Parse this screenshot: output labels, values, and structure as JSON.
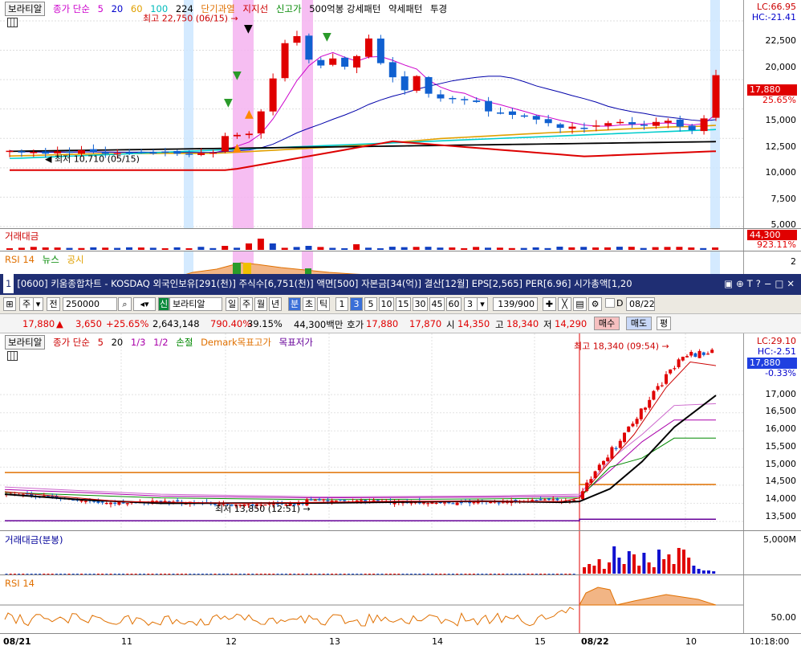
{
  "top_chart": {
    "legend": {
      "tag": "보라티알",
      "ma_label": "종가 단순",
      "ma_periods": [
        "5",
        "20",
        "60",
        "100",
        "224"
      ],
      "ma_colors": [
        "#cc00cc",
        "#0000cc",
        "#e0a000",
        "#00cccc",
        "#000000"
      ],
      "indicators": [
        "단기과열",
        "지지선",
        "신고가",
        "500억봉 강세패턴",
        "약세패턴",
        "투경"
      ]
    },
    "lc": "LC:66.95",
    "hc": "HC:-21.41",
    "price_ticks": [
      "22,500",
      "20,000",
      "17,500",
      "15,000",
      "12,500",
      "10,000",
      "7,500",
      "5,000"
    ],
    "current_price": "17,880",
    "current_change": "25.65%",
    "high_label": "최고 22,750 (06/15)",
    "low_label": "최저 10,710 (05/15)",
    "volume_label": "거래대금",
    "volume_value": "44,300",
    "volume_change": "923.11%",
    "rsi_label": "RSI 14",
    "news_label": "뉴스",
    "disclosure_label": "공시",
    "rsi_tick": "2"
  },
  "window": {
    "number": "1",
    "title": "[0600] 키움종합차트 - KOSDAQ 외국인보유[291(천)] 주식수[6,751(천)] 액면[500] 자본금[34(억)] 결산[12월] EPS[2,565] PER[6.96] 시가총액[1,20"
  },
  "toolbar": {
    "type_value": "주",
    "prev_label": "전",
    "code_value": "250000",
    "stock_tag": "신",
    "stock_name": "보라티알",
    "periods": [
      "일",
      "주",
      "월",
      "년",
      "분",
      "초",
      "틱"
    ],
    "active_period": "분",
    "intervals": [
      "1",
      "3",
      "5",
      "10",
      "15",
      "30",
      "45",
      "60"
    ],
    "active_interval": "3",
    "interval_select": "3",
    "count_value": "139/900",
    "date_value": "08/22",
    "d_label": "D"
  },
  "quote_bar": {
    "price": "17,880",
    "change": "3,650",
    "change_pct": "+25.65%",
    "volume": "2,643,148",
    "volume_ratio": "790.40%",
    "turnover": "39.15%",
    "amount": "44,300백만",
    "quote_label": "호가",
    "ask": "17,880",
    "bid": "17,870",
    "open_label": "시",
    "open": "14,350",
    "high_label": "고",
    "high": "18,340",
    "low_label": "저",
    "low": "14,290",
    "buy_label": "매수",
    "sell_label": "매도",
    "eval_label": "평"
  },
  "bottom_chart": {
    "legend": {
      "tag": "보라티알",
      "ma_label": "종가 단순",
      "ma_periods": [
        "5",
        "20"
      ],
      "extra": [
        "1/3",
        "1/2",
        "손절"
      ],
      "demark_high": "Demark목표고가",
      "demark_low": "목표저가"
    },
    "lc": "LC:29.10",
    "hc": "HC:-2.51",
    "price_ticks": [
      "17,000",
      "16,500",
      "16,000",
      "15,500",
      "15,000",
      "14,500",
      "14,000",
      "13,500"
    ],
    "current_price": "17,880",
    "current_change": "-0.33%",
    "high_label": "최고 18,340 (09:54)",
    "low_label": "최저 13,850 (12:51)",
    "volume_label": "거래대금(분봉)",
    "volume_tick": "5,000M",
    "rsi_label": "RSI 14",
    "rsi_tick": "50.00",
    "x_labels": [
      "08/21",
      "11",
      "12",
      "13",
      "14",
      "15",
      "08/22",
      "10"
    ],
    "time_label": "10:18:00"
  },
  "chart_data": [
    {
      "type": "candlestick",
      "title": "보라티알 주봉",
      "y_ticks": [
        5000,
        7500,
        10000,
        12500,
        15000,
        17500,
        20000,
        22500
      ],
      "ylim": [
        5000,
        24000
      ],
      "annotations": [
        {
          "label": "최고 22,750 (06/15)",
          "value": 22750
        },
        {
          "label": "최저 10,710 (05/15)",
          "value": 10710
        }
      ],
      "series": [
        {
          "name": "weekly_close",
          "values": [
            11450,
            11300,
            11350,
            11200,
            11400,
            11300,
            11500,
            11350,
            11200,
            11250,
            11300,
            11350,
            11300,
            11350,
            11200,
            11150,
            11250,
            11300,
            12700,
            12800,
            12900,
            14800,
            17600,
            20600,
            21200,
            19200,
            18700,
            19300,
            18600,
            19500,
            21000,
            18900,
            17700,
            16600,
            17800,
            16300,
            15900,
            15900,
            15800,
            15600,
            14800,
            14700,
            14500,
            14400,
            14100,
            13800,
            13400,
            13500,
            13400,
            13600,
            13800,
            13900,
            13700,
            13600,
            13900,
            14000,
            13500,
            13200,
            14200,
            17880
          ]
        }
      ]
    },
    {
      "type": "candlestick",
      "title": "보라티알 3분봉",
      "y_ticks": [
        13500,
        14000,
        14500,
        15000,
        15500,
        16000,
        16500,
        17000
      ],
      "ylim": [
        13300,
        18600
      ],
      "annotations": [
        {
          "label": "최고 18,340 (09:54)",
          "value": 18340
        },
        {
          "label": "최저 13,850 (12:51)",
          "value": 13850
        }
      ],
      "levels": [
        {
          "name": "Demark목표고가",
          "value": 14850
        },
        {
          "name": "목표저가",
          "value": 13550
        }
      ]
    }
  ]
}
